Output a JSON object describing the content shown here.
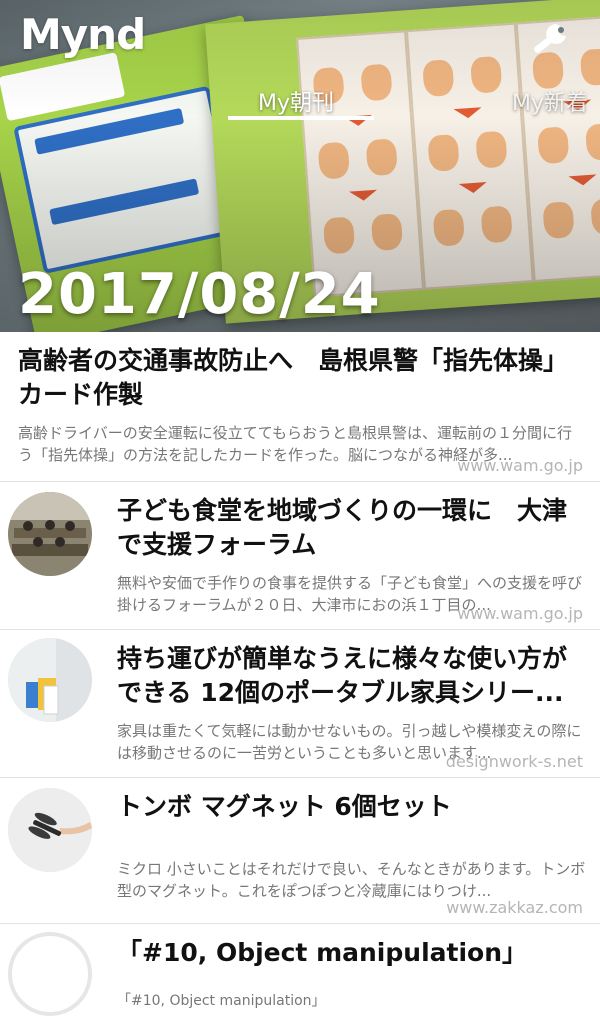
{
  "app": {
    "logo_text": "Mynd"
  },
  "header": {
    "tabs": [
      {
        "label": "My朝刊",
        "active": true
      },
      {
        "label": "My新着",
        "active": false
      }
    ],
    "settings_icon": "wrench-icon"
  },
  "hero": {
    "date": "2017/08/24"
  },
  "articles": [
    {
      "title": "高齢者の交通事故防止へ　島根県警「指先体操」カード作製",
      "description": "高齢ドライバーの安全運転に役立ててもらおうと島根県警は、運転前の１分間に行う「指先体操」の方法を記したカードを作った。脳につながる神経が多...",
      "source": "www.wam.go.jp"
    },
    {
      "title": "子ども食堂を地域づくりの一環に　大津で支援フォーラム",
      "description": "無料や安価で手作りの食事を提供する「子ども食堂」への支援を呼び掛けるフォーラムが２０日、大津市におの浜１丁目の...",
      "source": "www.wam.go.jp"
    },
    {
      "title": "持ち運びが簡単なうえに様々な使い方ができる 12個のポータブル家具シリー...",
      "description": "家具は重たくて気軽には動かせないもの。引っ越しや模様変えの際には移動させるのに一苦労ということも多いと思います...",
      "source": "designwork-s.net"
    },
    {
      "title": "トンボ マグネット 6個セット",
      "description": "ミクロ 小さいことはそれだけで良い、そんなときがあります。トンボ型のマグネット。これをぽつぽつと冷蔵庫にはりつけ...",
      "source": "www.zakkaz.com"
    },
    {
      "title": "「#10, Object manipulation」",
      "description": "「#10, Object manipulation」",
      "source": ""
    }
  ]
}
